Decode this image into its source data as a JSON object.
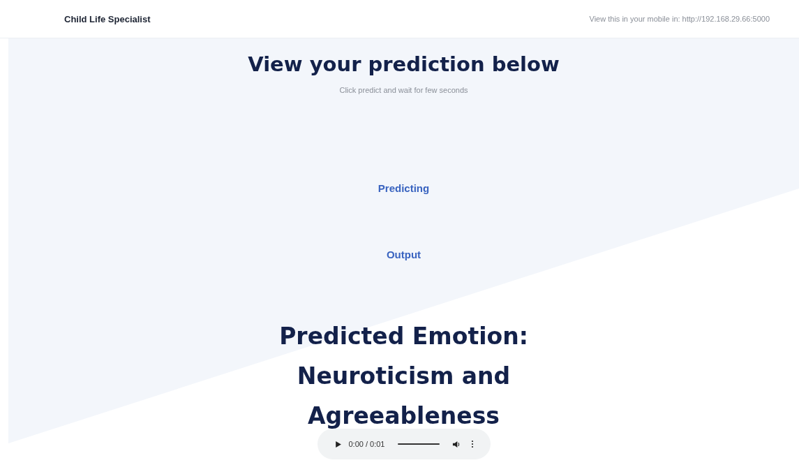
{
  "header": {
    "brand": "Child Life Specialist",
    "mobile_hint": "View this in your mobile in: http://192.168.29.66:5000"
  },
  "hero": {
    "title": "View your prediction below",
    "subtitle": "Click predict and wait for few seconds"
  },
  "status": "Predicting",
  "output_label": "Output",
  "result": "Predicted Emotion: Neuroticism and Agreeableness",
  "audio_player": {
    "time": "0:00 / 0:01",
    "level": 1
  }
}
